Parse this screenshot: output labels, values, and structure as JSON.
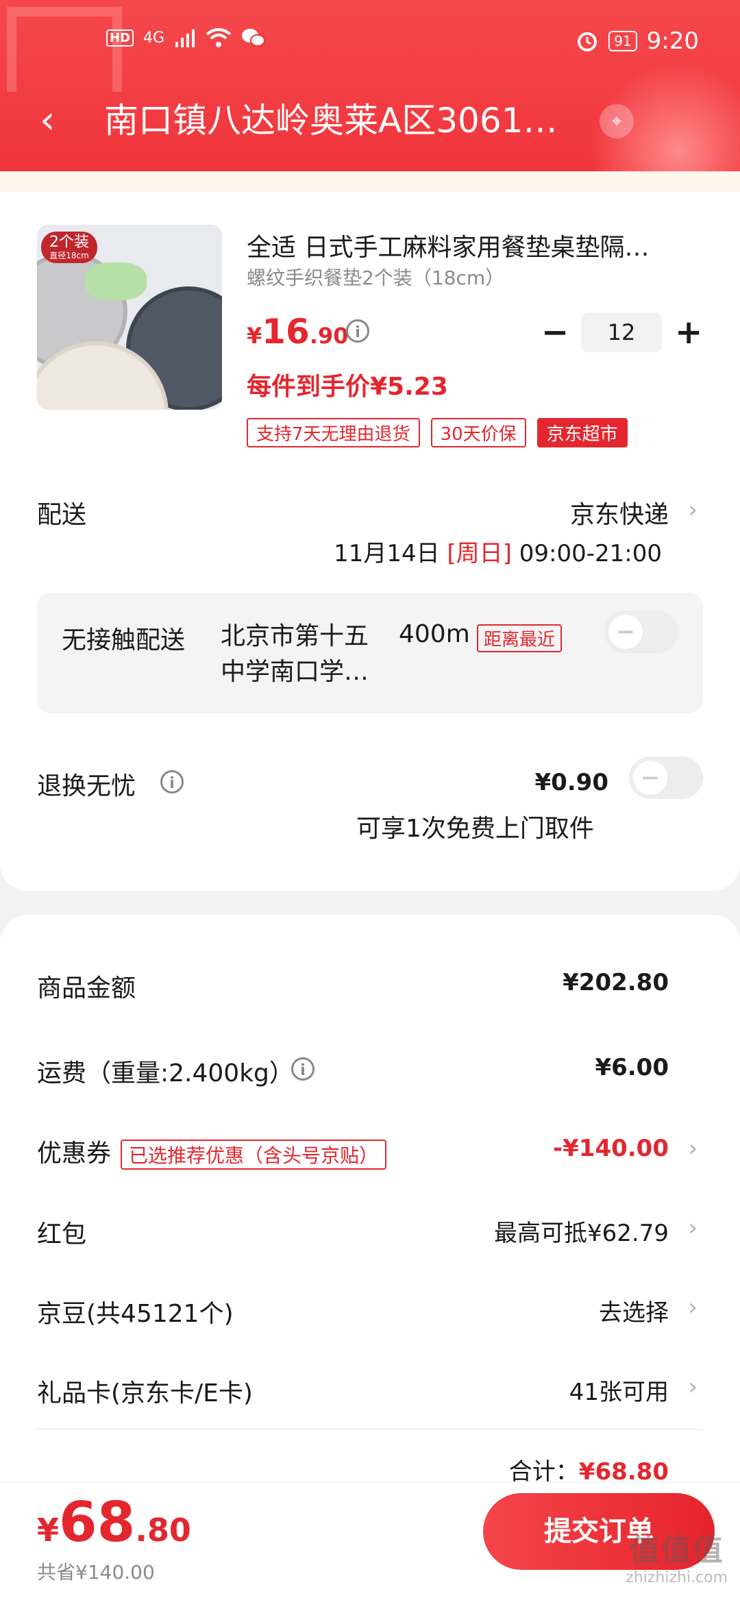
{
  "status_bar": {
    "hd": "HD",
    "network": "4G",
    "battery": "91",
    "time": "9:20"
  },
  "nav": {
    "back_glyph": "‹",
    "title": "南口镇八达岭奥莱A区3061…",
    "location_glyph": "⌖"
  },
  "product": {
    "image_tag": "2个装",
    "image_tag_sub": "直径18cm",
    "name": "全适 日式手工麻料家用餐垫桌垫隔…",
    "spec": "螺纹手织餐垫2个装（18cm）",
    "price_currency": "¥",
    "price_int": "16",
    "price_dec": ".90",
    "quantity": "12",
    "unit_price": "每件到手价¥5.23",
    "tags": [
      "支持7天无理由退货",
      "30天价保",
      "京东超市"
    ]
  },
  "delivery": {
    "label": "配送",
    "method": "京东快递",
    "date": "11月14日",
    "weekday": "[周日]",
    "time": "09:00-21:00"
  },
  "noncontact": {
    "label": "无接触配送",
    "address": "北京市第十五中学南口学…",
    "distance": "400m",
    "tag": "距离最近"
  },
  "return_service": {
    "label": "退换无忧",
    "price": "¥0.90",
    "desc": "可享1次免费上门取件"
  },
  "summary": {
    "goods_label": "商品金额",
    "goods_value": "¥202.80",
    "shipping_label": "运费（重量:2.400kg）",
    "shipping_value": "¥6.00",
    "coupon_label": "优惠券",
    "coupon_tag": "已选推荐优惠（含头号京贴）",
    "coupon_value": "-¥140.00",
    "redpacket_label": "红包",
    "redpacket_value": "最高可抵¥62.79",
    "beans_label": "京豆(共45121个)",
    "beans_value": "去选择",
    "giftcard_label": "礼品卡(京东卡/E卡)",
    "giftcard_value": "41张可用",
    "total_label": "合计：",
    "total_value": "¥68.80"
  },
  "bottom": {
    "price_currency": "¥",
    "price_int": "68",
    "price_dec": ".80",
    "saved": "共省¥140.00",
    "submit": "提交订单"
  },
  "watermark": {
    "text": "值值值",
    "url": "zhizhizhi.com"
  },
  "colors": {
    "brand_red": "#e4262e",
    "header_red": "#f23d42"
  },
  "icons": [
    "back-icon",
    "location-icon",
    "info-icon",
    "chevron-right-icon",
    "wifi-icon",
    "wechat-icon",
    "alarm-icon"
  ]
}
